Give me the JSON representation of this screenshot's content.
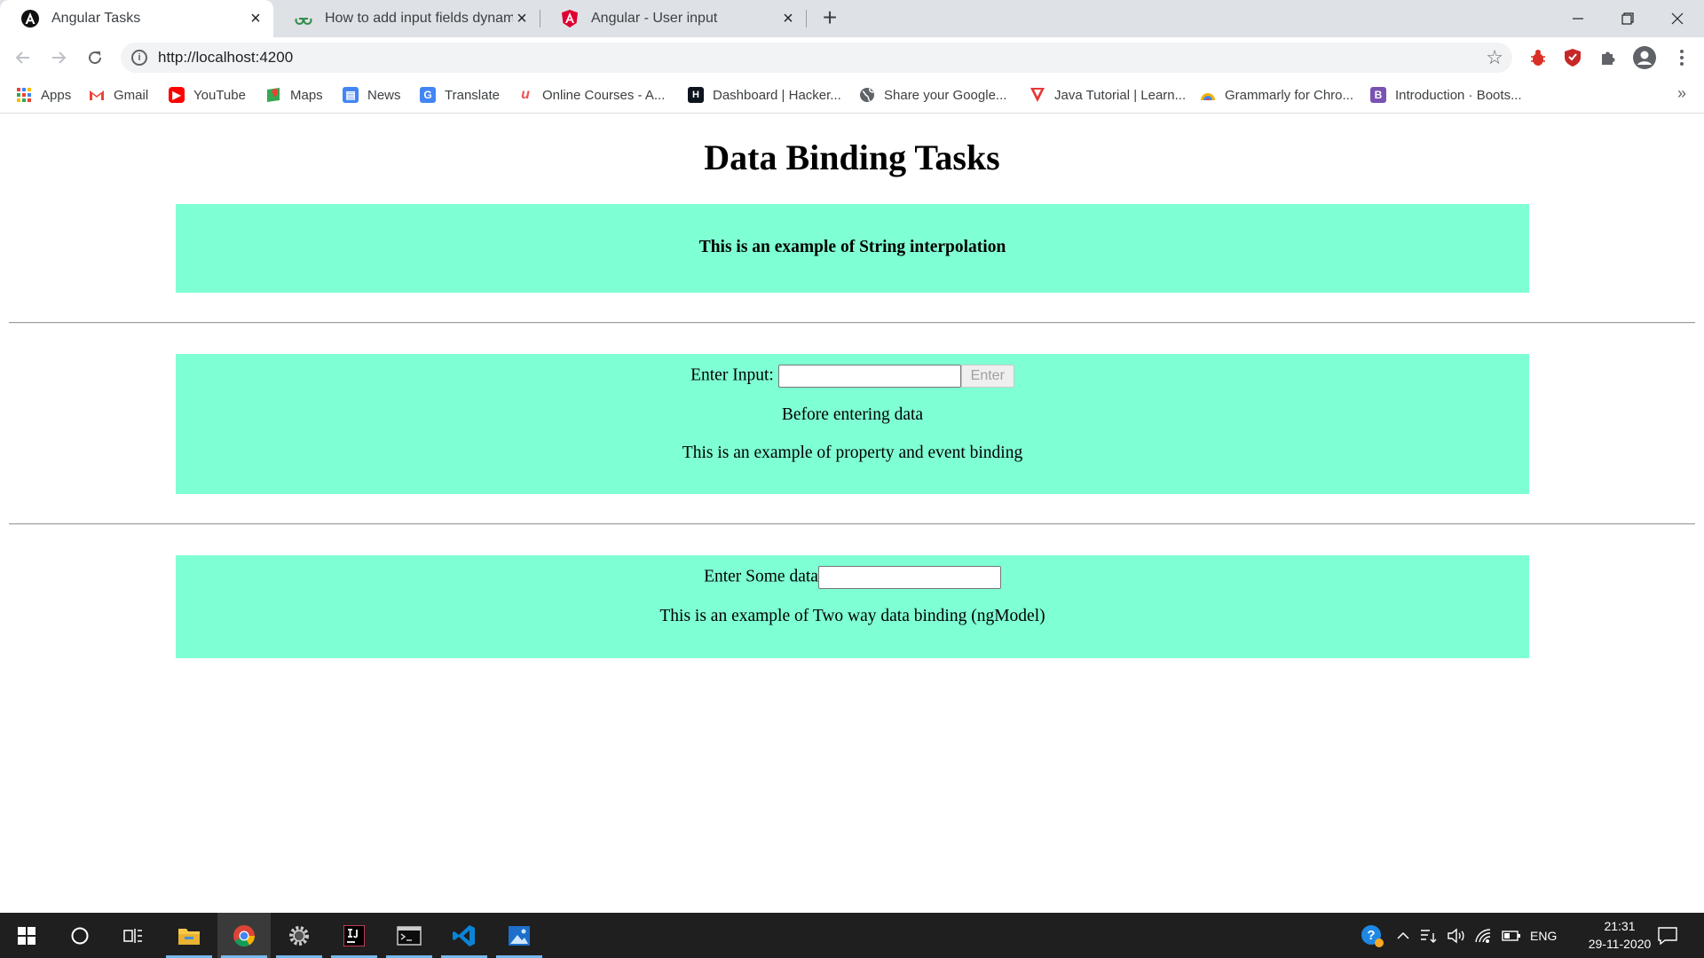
{
  "tabs": [
    {
      "title": "Angular Tasks",
      "favicon": "angular-dark-icon",
      "active": true
    },
    {
      "title": "How to add input fields dynamic",
      "favicon": "geeksforgeeks-icon",
      "active": false
    },
    {
      "title": "Angular - User input",
      "favicon": "angular-red-icon",
      "active": false
    }
  ],
  "toolbar": {
    "url": "http://localhost:4200"
  },
  "bookmarks": [
    {
      "label": "Apps",
      "icon": "apps-grid-icon"
    },
    {
      "label": "Gmail",
      "icon": "gmail-icon"
    },
    {
      "label": "YouTube",
      "icon": "youtube-icon"
    },
    {
      "label": "Maps",
      "icon": "maps-icon"
    },
    {
      "label": "News",
      "icon": "news-icon"
    },
    {
      "label": "Translate",
      "icon": "translate-icon"
    },
    {
      "label": "Online Courses - A...",
      "icon": "udemy-icon"
    },
    {
      "label": "Dashboard | Hacker...",
      "icon": "hackerrank-icon"
    },
    {
      "label": "Share your Google...",
      "icon": "globe-icon"
    },
    {
      "label": "Java Tutorial | Learn...",
      "icon": "java-tutorial-icon"
    },
    {
      "label": "Grammarly for Chro...",
      "icon": "grammarly-icon"
    },
    {
      "label": "Introduction · Boots...",
      "icon": "bootstrap-icon"
    }
  ],
  "page": {
    "heading": "Data Binding Tasks",
    "section1": {
      "text": "This is an example of String interpolation"
    },
    "section2": {
      "input_label": "Enter Input:",
      "input_value": "",
      "button_label": "Enter",
      "status_text": "Before entering data",
      "caption": "This is an example of property and event binding"
    },
    "section3": {
      "input_label": "Enter Some data",
      "input_value": "",
      "caption": "This is an example of Two way data binding (ngModel)"
    }
  },
  "taskbar": {
    "language": "ENG",
    "time": "21:31",
    "date": "29-11-2020"
  }
}
